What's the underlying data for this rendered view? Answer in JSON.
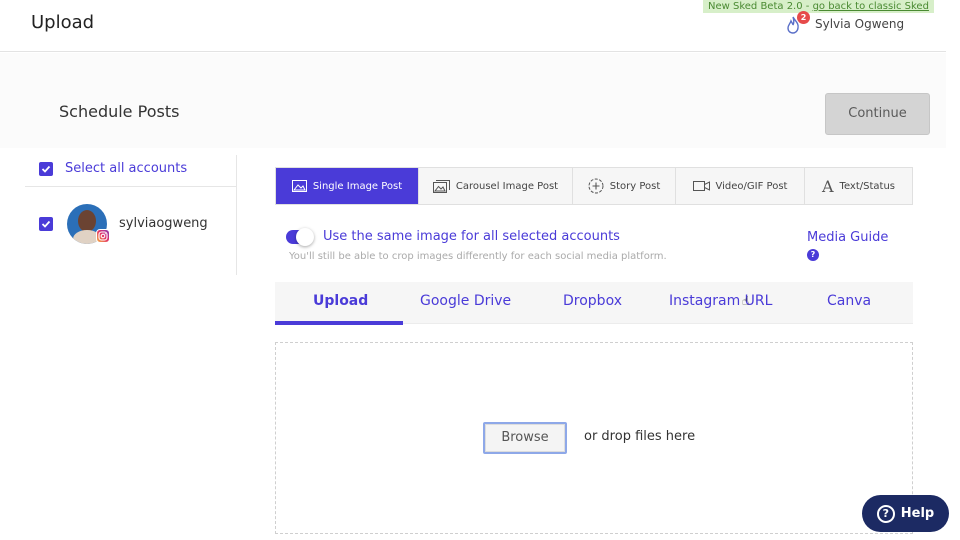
{
  "header": {
    "title": "Upload",
    "beta_banner": {
      "text": "New Sked Beta 2.0 - ",
      "link": "go back to classic Sked"
    },
    "notifications_count": "2",
    "user_name": "Sylvia Ogweng"
  },
  "schedule": {
    "title": "Schedule Posts",
    "continue_label": "Continue"
  },
  "accounts": {
    "select_all_label": "Select all accounts",
    "items": [
      {
        "name": "sylviaogweng",
        "platform": "instagram",
        "checked": true
      }
    ]
  },
  "post_types": [
    {
      "label": "Single Image Post",
      "icon": "image-icon",
      "active": true
    },
    {
      "label": "Carousel Image Post",
      "icon": "carousel-icon",
      "active": false
    },
    {
      "label": "Story Post",
      "icon": "story-icon",
      "active": false
    },
    {
      "label": "Video/GIF Post",
      "icon": "video-icon",
      "active": false
    },
    {
      "label": "Text/Status",
      "icon": "text-icon",
      "active": false
    }
  ],
  "same_image": {
    "label": "Use the same image for all selected accounts",
    "subtext": "You'll still be able to crop images differently for each social media platform.",
    "enabled": true
  },
  "media_guide": {
    "label": "Media Guide",
    "help_glyph": "?"
  },
  "upload_sources": [
    {
      "label": "Upload",
      "active": true
    },
    {
      "label": "Google Drive",
      "active": false
    },
    {
      "label": "Dropbox",
      "active": false
    },
    {
      "label": "Instagram URL",
      "active": false
    },
    {
      "label": "Canva",
      "active": false
    }
  ],
  "dropzone": {
    "browse_label": "Browse",
    "drop_text": "or drop files here"
  },
  "help_button": {
    "icon_glyph": "?",
    "label": "Help"
  },
  "colors": {
    "accent": "#4a3bd8",
    "help_bg": "#1c2a63",
    "badge": "#e64a4a",
    "beta_bg": "#d7efc9"
  }
}
